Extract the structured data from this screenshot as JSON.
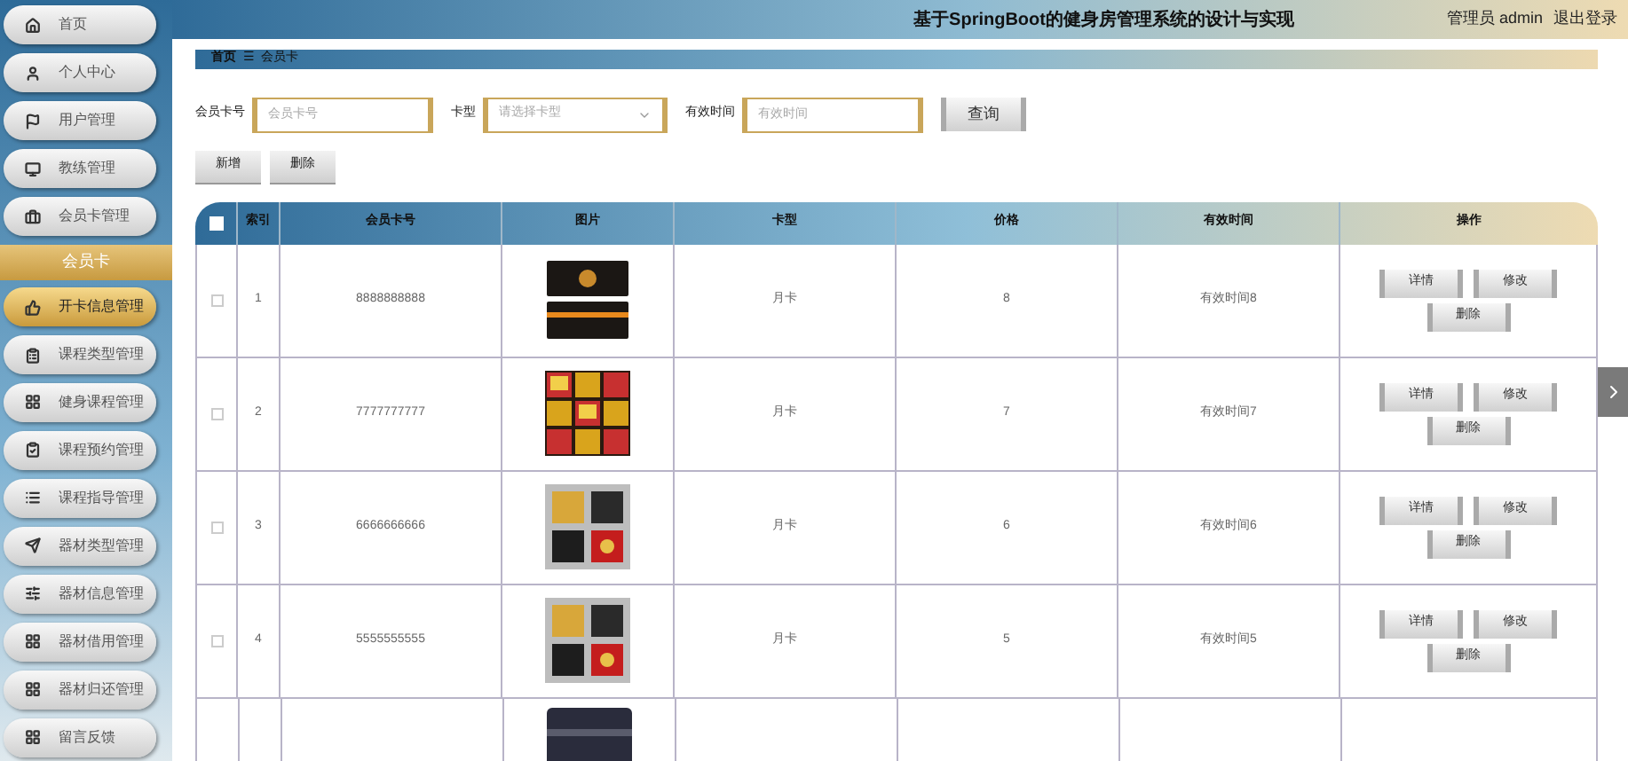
{
  "sidebar": {
    "items": [
      {
        "kind": "item",
        "label": "首页",
        "selected": false
      },
      {
        "kind": "item",
        "label": "个人中心",
        "selected": false
      },
      {
        "kind": "item",
        "label": "用户管理",
        "selected": false
      },
      {
        "kind": "item",
        "label": "教练管理",
        "selected": false
      },
      {
        "kind": "item",
        "label": "会员卡管理",
        "selected": false
      },
      {
        "kind": "group",
        "label": "会员卡",
        "selected": false
      },
      {
        "kind": "item",
        "label": "开卡信息管理",
        "selected": true
      },
      {
        "kind": "item",
        "label": "课程类型管理",
        "selected": false
      },
      {
        "kind": "item",
        "label": "健身课程管理",
        "selected": false
      },
      {
        "kind": "item",
        "label": "课程预约管理",
        "selected": false
      },
      {
        "kind": "item",
        "label": "课程指导管理",
        "selected": false
      },
      {
        "kind": "item",
        "label": "器材类型管理",
        "selected": false
      },
      {
        "kind": "item",
        "label": "器材信息管理",
        "selected": false
      },
      {
        "kind": "item",
        "label": "器材借用管理",
        "selected": false
      },
      {
        "kind": "item",
        "label": "器材归还管理",
        "selected": false
      },
      {
        "kind": "item",
        "label": "留言反馈",
        "selected": false
      }
    ]
  },
  "header": {
    "title": "基于SpringBoot的健身房管理系统的设计与实现",
    "user": "管理员 admin",
    "logout": "退出登录"
  },
  "breadcrumb": {
    "home": "首页",
    "separator": "☰",
    "current": "会员卡"
  },
  "search": {
    "fields": [
      {
        "kind": "input",
        "label": "会员卡号",
        "placeholder": "会员卡号"
      },
      {
        "kind": "select",
        "label": "卡型",
        "placeholder": "请选择卡型"
      },
      {
        "kind": "input",
        "label": "有效时间",
        "placeholder": "有效时间"
      }
    ],
    "button": "查询"
  },
  "actions": [
    "新增",
    "删除"
  ],
  "table": {
    "select_all": {
      "checked": false
    },
    "columns": [
      "索引",
      "会员卡号",
      "图片",
      "卡型",
      "价格",
      "有效时间",
      "操作"
    ],
    "rows": [
      {
        "checked": false,
        "index": "1",
        "card_no": "8888888888",
        "type": "月卡",
        "price": "8",
        "valid": "有效时间8",
        "buttons": [
          "详情",
          "修改",
          "删除"
        ]
      },
      {
        "checked": false,
        "index": "2",
        "card_no": "7777777777",
        "type": "月卡",
        "price": "7",
        "valid": "有效时间7",
        "buttons": [
          "详情",
          "修改",
          "删除"
        ]
      },
      {
        "checked": false,
        "index": "3",
        "card_no": "6666666666",
        "type": "月卡",
        "price": "6",
        "valid": "有效时间6",
        "buttons": [
          "详情",
          "修改",
          "删除"
        ]
      },
      {
        "checked": false,
        "index": "4",
        "card_no": "5555555555",
        "type": "月卡",
        "price": "5",
        "valid": "有效时间5",
        "buttons": [
          "详情",
          "修改",
          "删除"
        ]
      }
    ]
  }
}
